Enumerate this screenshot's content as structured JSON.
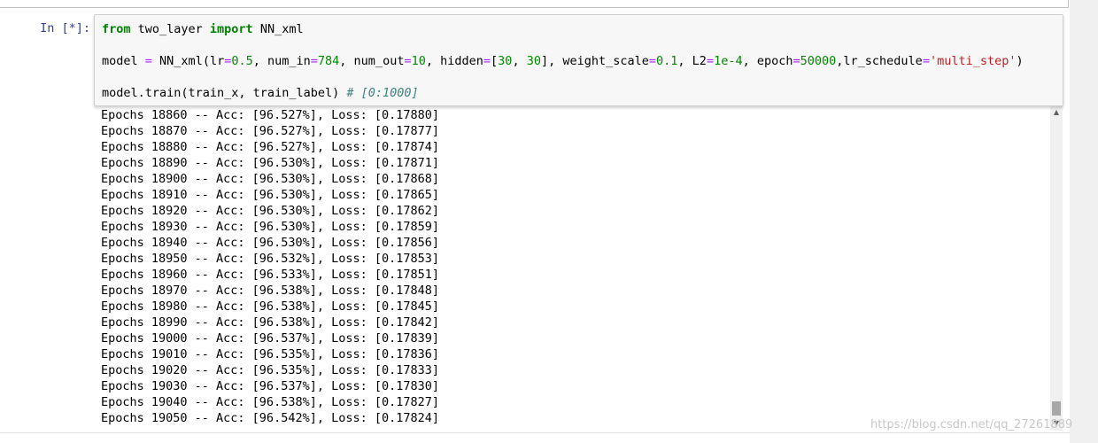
{
  "cell": {
    "prompt": "In [*]:",
    "code": {
      "line1": {
        "kw1": "from",
        "mid": " two_layer ",
        "kw2": "import",
        "end": " NN_xml"
      },
      "line2": {
        "a": "model ",
        "eq": "=",
        "b": " NN_xml(lr",
        "eq2": "=",
        "n1": "0.5",
        "c": ", num_in",
        "eq3": "=",
        "n2": "784",
        "d": ", num_out",
        "eq4": "=",
        "n3": "10",
        "e": ", hidden",
        "eq5": "=",
        "f": "[",
        "n4": "30",
        "g": ", ",
        "n5": "30",
        "h": "], weight_scale",
        "eq6": "=",
        "n6": "0.1",
        "i": ", L2",
        "eq7": "=",
        "n7": "1e-4",
        "j": ", epoch",
        "eq8": "=",
        "n8": "50000",
        "k": ",lr_schedule",
        "eq9": "=",
        "s1": "'multi_step'",
        "l": ")"
      },
      "line3": {
        "a": "model.train(train_x, train_label) ",
        "comment": "# [0:1000]"
      }
    }
  },
  "output": {
    "lines": [
      "Epochs 18860 -- Acc: [96.527%], Loss: [0.17880]",
      "Epochs 18870 -- Acc: [96.527%], Loss: [0.17877]",
      "Epochs 18880 -- Acc: [96.527%], Loss: [0.17874]",
      "Epochs 18890 -- Acc: [96.530%], Loss: [0.17871]",
      "Epochs 18900 -- Acc: [96.530%], Loss: [0.17868]",
      "Epochs 18910 -- Acc: [96.530%], Loss: [0.17865]",
      "Epochs 18920 -- Acc: [96.530%], Loss: [0.17862]",
      "Epochs 18930 -- Acc: [96.530%], Loss: [0.17859]",
      "Epochs 18940 -- Acc: [96.530%], Loss: [0.17856]",
      "Epochs 18950 -- Acc: [96.532%], Loss: [0.17853]",
      "Epochs 18960 -- Acc: [96.533%], Loss: [0.17851]",
      "Epochs 18970 -- Acc: [96.538%], Loss: [0.17848]",
      "Epochs 18980 -- Acc: [96.538%], Loss: [0.17845]",
      "Epochs 18990 -- Acc: [96.538%], Loss: [0.17842]",
      "Epochs 19000 -- Acc: [96.537%], Loss: [0.17839]",
      "Epochs 19010 -- Acc: [96.535%], Loss: [0.17836]",
      "Epochs 19020 -- Acc: [96.535%], Loss: [0.17833]",
      "Epochs 19030 -- Acc: [96.537%], Loss: [0.17830]",
      "Epochs 19040 -- Acc: [96.538%], Loss: [0.17827]",
      "Epochs 19050 -- Acc: [96.542%], Loss: [0.17824]"
    ]
  },
  "watermark": "https://blog.csdn.net/qq_27261889",
  "colors": {
    "prompt": "#303f9f",
    "keyword": "#008000",
    "number": "#008800",
    "string": "#ba2121",
    "comment": "#408080",
    "operator": "#aa22ff",
    "input_bg": "#f7f7f7"
  },
  "icons": {
    "scroll_up": "▲",
    "scroll_down": "▼"
  }
}
